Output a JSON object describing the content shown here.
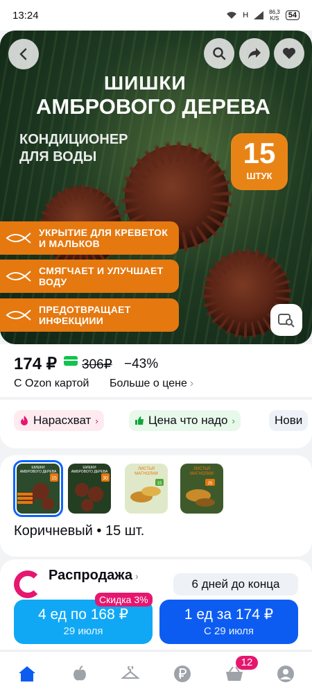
{
  "status_bar": {
    "time": "13:24",
    "network_label": "H",
    "speed_value": "86,3",
    "speed_unit": "K/S",
    "battery": "54"
  },
  "hero": {
    "title_line1": "ШИШКИ",
    "title_line2": "АМБРОВОГО ДЕРЕВА",
    "subtitle_line1": "КОНДИЦИОНЕР",
    "subtitle_line2": "ДЛЯ ВОДЫ",
    "count_number": "15",
    "count_unit": "ШТУК",
    "features": [
      {
        "line1": "УКРЫТИЕ ДЛЯ КРЕВЕТОК",
        "line2": "И МАЛЬКОВ"
      },
      {
        "line1": "СМЯГЧАЕТ И УЛУЧШАЕТ",
        "line2": "ВОДУ"
      },
      {
        "line1": "ПРЕДОТВРАЩАЕТ",
        "line2": "ИНФЕКЦИИИ"
      }
    ]
  },
  "price": {
    "current": "174 ₽",
    "old": "306₽",
    "discount": "−43%",
    "ozon_card": "С Ozon картой",
    "more": "Больше о цене"
  },
  "chips": {
    "hot": "Нарасхват",
    "good_price": "Цена что надо",
    "new": "Нови"
  },
  "variants": {
    "thumbs": [
      {
        "line1": "ШИШКИ",
        "line2": "АМБРОВОГО ДЕРЕВА",
        "count": "15"
      },
      {
        "line1": "ШИШКИ",
        "line2": "АМБРОВОГО ДЕРЕВА",
        "count": "30"
      },
      {
        "line1": "ЛИСТЬЯ",
        "line2": "МАГНОЛИИ",
        "count": "15"
      },
      {
        "line1": "ЛИСТЬЯ",
        "line2": "МАГНОЛИИ",
        "count": "25"
      }
    ],
    "selected_label": "Коричневый • 15 шт."
  },
  "sale": {
    "title": "Распродажа",
    "days_left": "6 дней до конца",
    "discount_tag": "Скидка 3%",
    "offer_left_main": "4 ед по 168 ₽",
    "offer_left_sub": "29 июля",
    "offer_right_main": "1 ед за 174 ₽",
    "offer_right_sub": "С 29 июля"
  },
  "bottom_nav": {
    "cart_count": "12"
  },
  "colors": {
    "accent_blue": "#0d5cf2",
    "light_blue": "#10a8f5",
    "ozon_pink": "#e5176e",
    "green": "#10c44c",
    "orange": "#e5780f"
  }
}
